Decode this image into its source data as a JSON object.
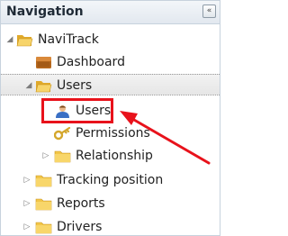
{
  "panel": {
    "title": "Navigation",
    "collapse_icon": "double-chevron-left-icon",
    "collapse_glyph": "«"
  },
  "tree": {
    "root": {
      "label": "NaviTrack",
      "icon": "folder-open-icon",
      "state": "expanded"
    },
    "dashboard": {
      "label": "Dashboard",
      "icon": "box-icon"
    },
    "users": {
      "label": "Users",
      "icon": "folder-open-icon",
      "state": "expanded"
    },
    "users_child": {
      "label": "Users",
      "icon": "user-icon",
      "highlighted": true
    },
    "permissions": {
      "label": "Permissions",
      "icon": "key-icon"
    },
    "relationship": {
      "label": "Relationship",
      "icon": "folder-icon",
      "state": "collapsed"
    },
    "tracking_position": {
      "label": "Tracking position",
      "icon": "folder-icon",
      "state": "collapsed"
    },
    "reports": {
      "label": "Reports",
      "icon": "folder-icon",
      "state": "collapsed"
    },
    "drivers": {
      "label": "Drivers",
      "icon": "folder-icon",
      "state": "collapsed"
    }
  },
  "colors": {
    "annotation_red": "#e8121b",
    "folder_yellow": "#f5c542",
    "selected_row_bg": "#ebebeb"
  }
}
